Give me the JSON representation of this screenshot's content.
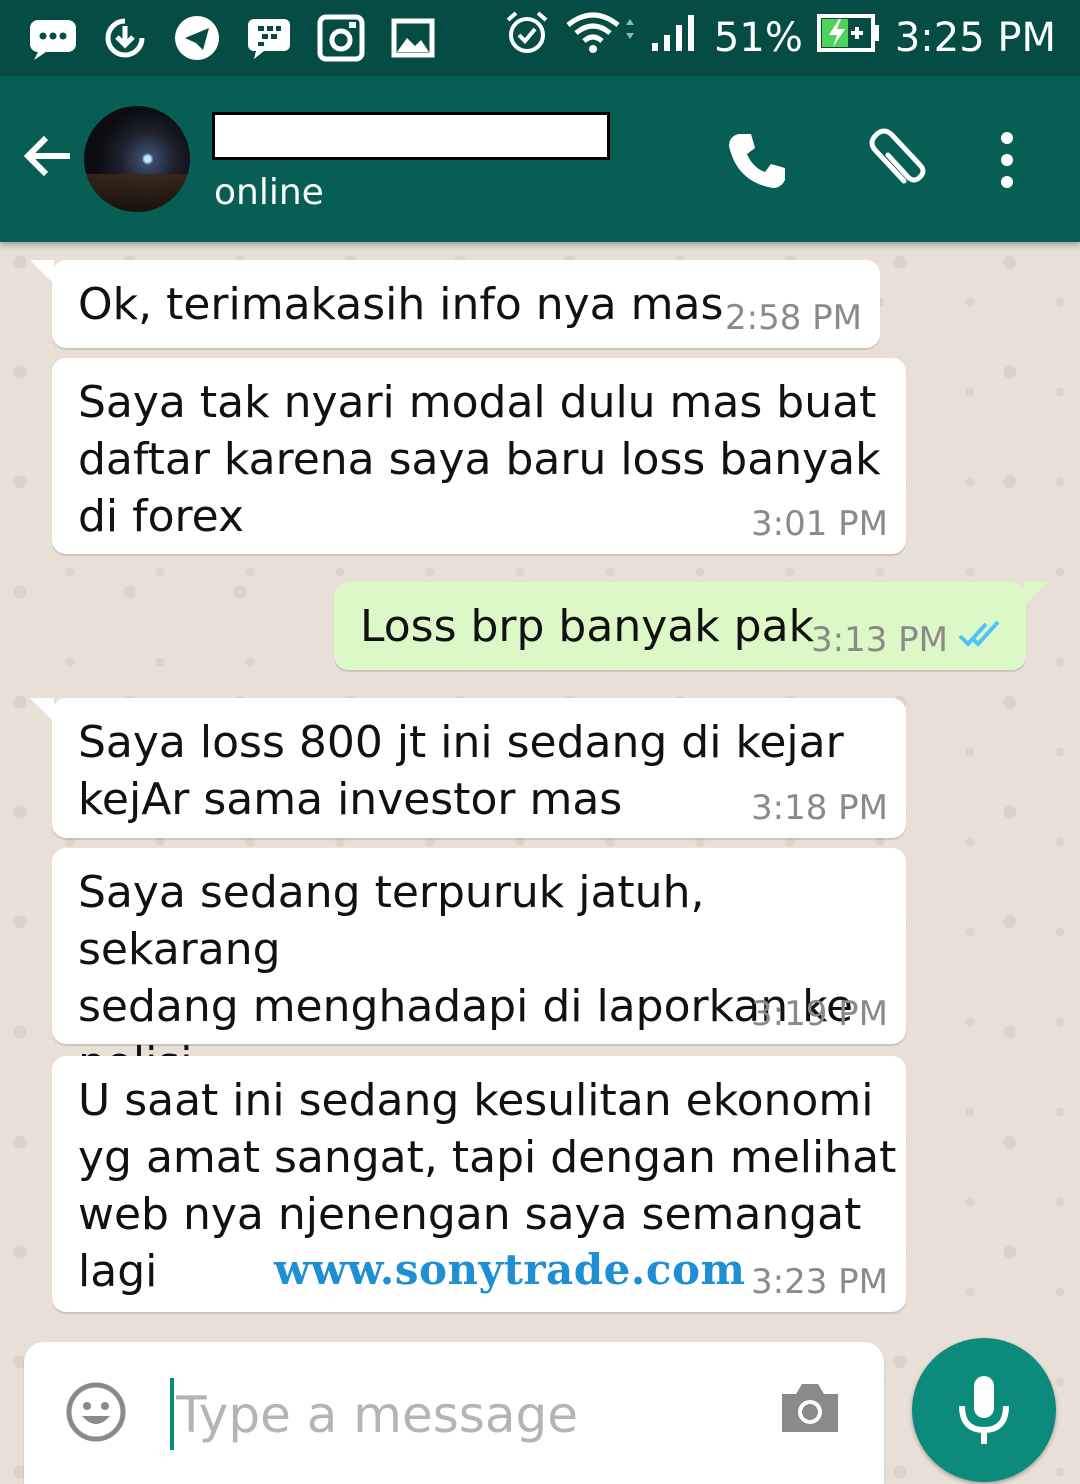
{
  "status_bar": {
    "battery_percent": "51%",
    "time": "3:25 PM",
    "icons": [
      "messages-icon",
      "download-icon",
      "telegram-icon",
      "bbm-icon",
      "instagram-icon",
      "gallery-icon",
      "alarm-icon",
      "wifi-icon",
      "signal-icon",
      "battery-charging-icon"
    ]
  },
  "header": {
    "contact_status": "online",
    "icons": [
      "back-arrow-icon",
      "phone-icon",
      "attach-icon",
      "more-vert-icon"
    ],
    "color": "#075e54"
  },
  "messages": [
    {
      "direction": "in",
      "text": "Ok, terimakasih info nya mas",
      "time": "2:58 PM"
    },
    {
      "direction": "in",
      "text": "Saya tak nyari modal dulu mas buat\ndaftar karena saya baru loss banyak\ndi forex",
      "time": "3:01 PM"
    },
    {
      "direction": "out",
      "text": "Loss brp banyak pak",
      "time": "3:13 PM",
      "status": "read"
    },
    {
      "direction": "in",
      "text": "Saya loss 800 jt ini sedang di kejar\nkejAr sama investor mas",
      "time": "3:18 PM"
    },
    {
      "direction": "in",
      "text": "Saya sedang terpuruk jatuh, sekarang\nsedang menghadapi di laporkan ke\npolisi,",
      "time": "3:19 PM"
    },
    {
      "direction": "in",
      "text": "U saat ini sedang kesulitan ekonomi\nyg amat sangat, tapi dengan melihat\nweb nya njenengan saya semangat\nlagi",
      "time": "3:23 PM"
    }
  ],
  "watermark": "www.sonytrade.com",
  "composer": {
    "placeholder": "Type a message",
    "icons": [
      "emoji-icon",
      "camera-icon",
      "mic-icon"
    ]
  },
  "colors": {
    "incoming_bubble": "#ffffff",
    "outgoing_bubble": "#dcf8c6",
    "read_ticks": "#4fc3f7",
    "mic_button": "#0c8a7b"
  }
}
